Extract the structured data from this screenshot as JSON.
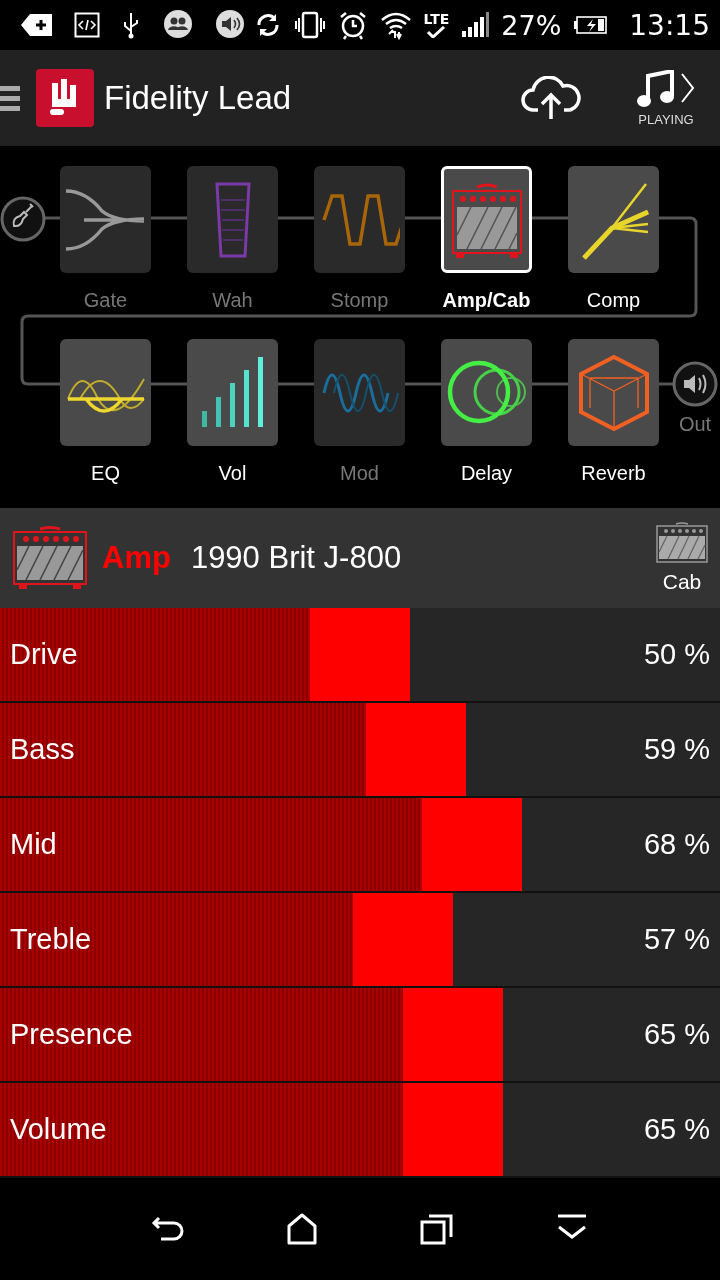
{
  "status_bar": {
    "network": "LTE",
    "battery": "27%",
    "time": "13:15"
  },
  "header": {
    "title": "Fidelity Lead",
    "now_playing": "PLAYING"
  },
  "chain": {
    "output": "Out",
    "rows": [
      [
        {
          "kind": "gate",
          "label": "Gate",
          "enabled": false,
          "selected": false
        },
        {
          "kind": "wah",
          "label": "Wah",
          "enabled": false,
          "selected": false
        },
        {
          "kind": "stomp",
          "label": "Stomp",
          "enabled": false,
          "selected": false
        },
        {
          "kind": "amp",
          "label": "Amp/Cab",
          "enabled": true,
          "selected": true
        },
        {
          "kind": "comp",
          "label": "Comp",
          "enabled": true,
          "selected": false
        }
      ],
      [
        {
          "kind": "eq",
          "label": "EQ",
          "enabled": true,
          "selected": false
        },
        {
          "kind": "vol",
          "label": "Vol",
          "enabled": true,
          "selected": false
        },
        {
          "kind": "mod",
          "label": "Mod",
          "enabled": false,
          "selected": false
        },
        {
          "kind": "delay",
          "label": "Delay",
          "enabled": true,
          "selected": false
        },
        {
          "kind": "reverb",
          "label": "Reverb",
          "enabled": true,
          "selected": false
        }
      ]
    ]
  },
  "model": {
    "section": "Amp",
    "name": "1990 Brit J-800",
    "switch_label": "Cab"
  },
  "params": [
    {
      "label": "Drive",
      "level": 0.5,
      "reading": "50 %"
    },
    {
      "label": "Bass",
      "level": 0.59,
      "reading": "59 %"
    },
    {
      "label": "Mid",
      "level": 0.68,
      "reading": "68 %"
    },
    {
      "label": "Treble",
      "level": 0.57,
      "reading": "57 %"
    },
    {
      "label": "Presence",
      "level": 0.65,
      "reading": "65 %"
    },
    {
      "label": "Volume",
      "level": 0.65,
      "reading": "65 %"
    }
  ]
}
